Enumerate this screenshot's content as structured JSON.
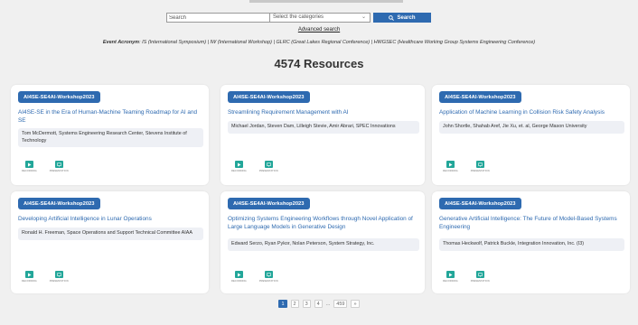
{
  "search": {
    "placeholder": "Search",
    "category_placeholder": "Select the categories",
    "button_label": "Search"
  },
  "advanced_search": "Advanced search",
  "event_acronym": {
    "label": "Event Acronym",
    "text": ": IS (International Symposium) | IW (International Workshop) | GLRC (Great Lakes Regional Conference) | HWGSEC (Healthcare Working Group Systems Engineering Conference)"
  },
  "resource_count": "4574 Resources",
  "cards": [
    {
      "badge": "AI4SE-SE4AI-Workshop2023",
      "title": "AI4SE-SE in the Era of Human-Machine Teaming Roadmap for AI and SE",
      "authors": "Tom McDermott, Systems Engineering Research Center, Stevens Institute of Technology",
      "recording": "RECORDING",
      "presentation": "PRESENTATION"
    },
    {
      "badge": "AI4SE-SE4AI-Workshop2023",
      "title": "Streamlining Requirement Management with AI",
      "authors": "Michael Jordan, Steven Dam, Lilleigh Stevie, Amir Abrari, SPEC Innovations",
      "recording": "RECORDING",
      "presentation": "PRESENTATION"
    },
    {
      "badge": "AI4SE-SE4AI-Workshop2023",
      "title": "Application of Machine Learning in Collision Risk Safety Analysis",
      "authors": "John Shortle, Shahab Aref, Jie Xu, et. al, George Mason University",
      "recording": "RECORDING",
      "presentation": "PRESENTATION"
    },
    {
      "badge": "AI4SE-SE4AI-Workshop2023",
      "title": "Developing Artificial Intelligence in Lunar Operations",
      "authors": "Ronald H. Freeman, Space Operations and Support Technical Committee AIAA",
      "recording": "RECORDING",
      "presentation": "PRESENTATION"
    },
    {
      "badge": "AI4SE-SE4AI-Workshop2023",
      "title": "Optimizing Systems Engineering Workflows through Novel Application of Large Language Models in Generative Design",
      "authors": "Edward Serzo, Ryan Pykor, Nolan Peterson, System Strategy, Inc.",
      "recording": "RECORDING",
      "presentation": "PRESENTATION"
    },
    {
      "badge": "AI4SE-SE4AI-Workshop2023",
      "title": "Generative Artificial Intelligence: The Future of Model-Based Systems Engineering",
      "authors": "Thomas Heckwolf, Patrick Buckle, Integration Innovation, Inc. (I3)",
      "recording": "RECORDING",
      "presentation": "PRESENTATION"
    }
  ],
  "pagination": {
    "pages": [
      "1",
      "2",
      "3",
      "4"
    ],
    "ellipsis": "...",
    "last": "459",
    "next": "»",
    "current": "1"
  },
  "colors": {
    "accent": "#2e6ab0",
    "icon_teal": "#22a699",
    "background": "#f0f0f0"
  }
}
